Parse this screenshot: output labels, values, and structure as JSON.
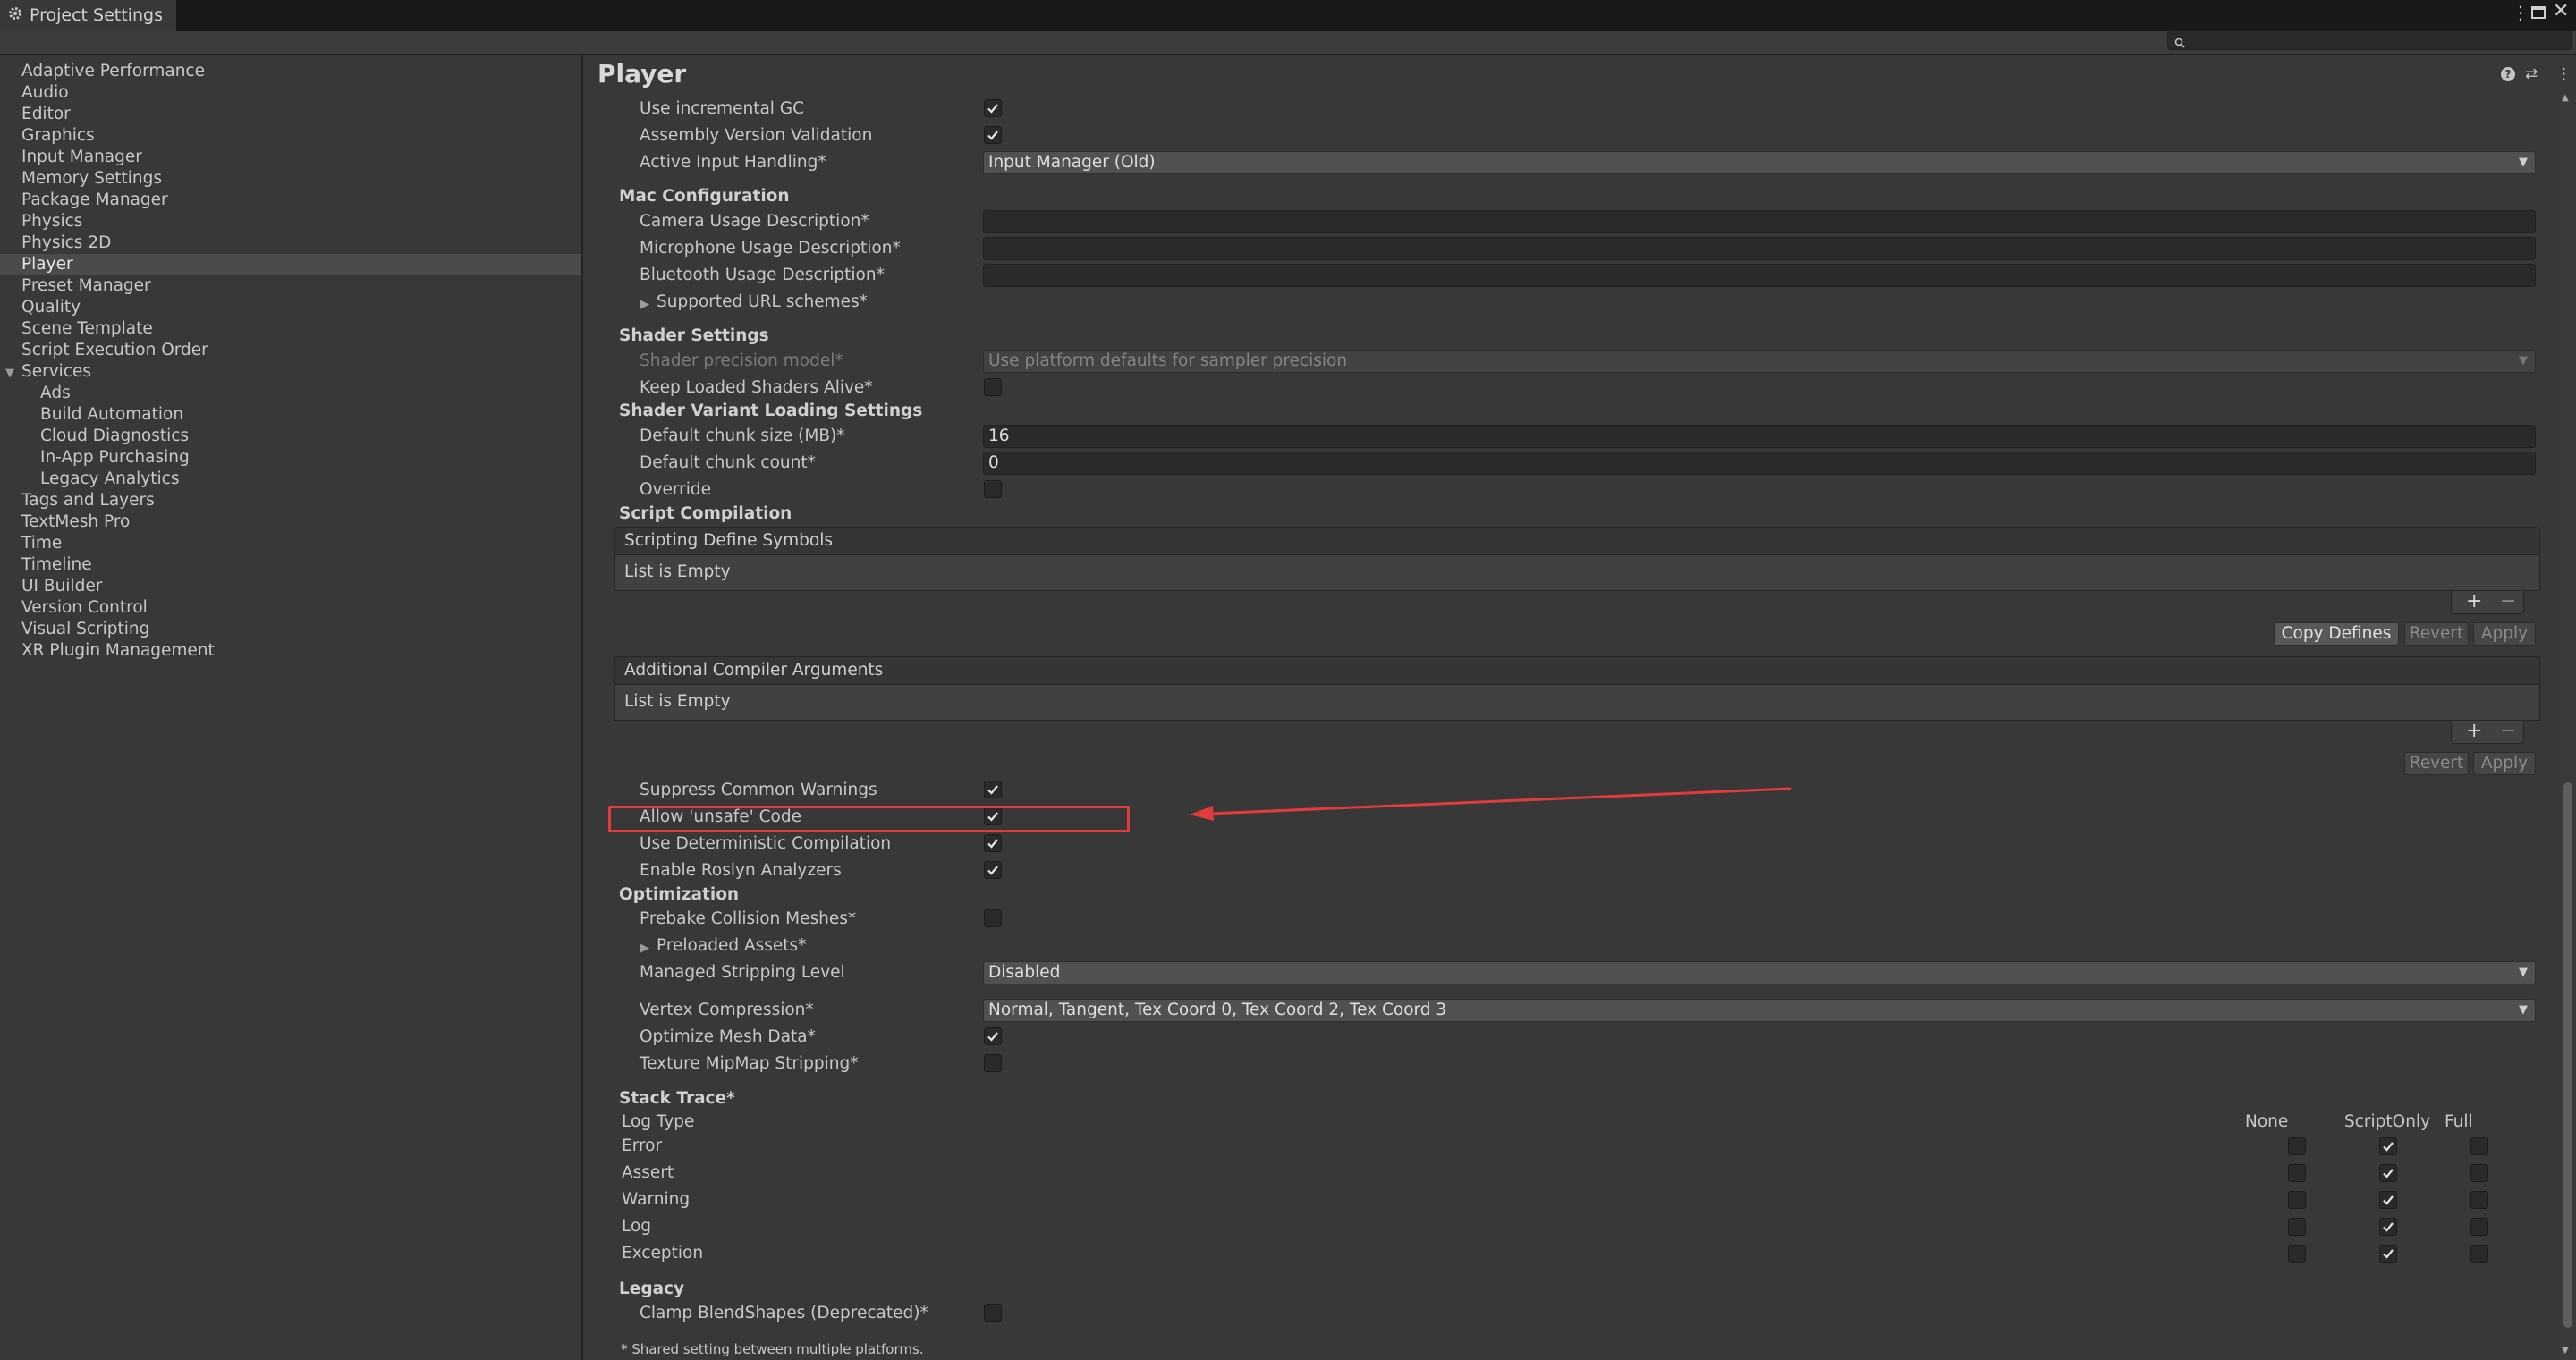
{
  "window": {
    "title": "Project Settings"
  },
  "sidebar": {
    "items": [
      {
        "label": "Adaptive Performance"
      },
      {
        "label": "Audio"
      },
      {
        "label": "Editor"
      },
      {
        "label": "Graphics"
      },
      {
        "label": "Input Manager"
      },
      {
        "label": "Memory Settings"
      },
      {
        "label": "Package Manager"
      },
      {
        "label": "Physics"
      },
      {
        "label": "Physics 2D"
      },
      {
        "label": "Player"
      },
      {
        "label": "Preset Manager"
      },
      {
        "label": "Quality"
      },
      {
        "label": "Scene Template"
      },
      {
        "label": "Script Execution Order"
      },
      {
        "label": "Services"
      },
      {
        "label": "Ads"
      },
      {
        "label": "Build Automation"
      },
      {
        "label": "Cloud Diagnostics"
      },
      {
        "label": "In-App Purchasing"
      },
      {
        "label": "Legacy Analytics"
      },
      {
        "label": "Tags and Layers"
      },
      {
        "label": "TextMesh Pro"
      },
      {
        "label": "Time"
      },
      {
        "label": "Timeline"
      },
      {
        "label": "UI Builder"
      },
      {
        "label": "Version Control"
      },
      {
        "label": "Visual Scripting"
      },
      {
        "label": "XR Plugin Management"
      }
    ],
    "selected": "Player"
  },
  "main": {
    "title": "Player",
    "rows": {
      "use_incremental_gc": {
        "label": "Use incremental GC",
        "checked": true
      },
      "assembly_version_validation": {
        "label": "Assembly Version Validation",
        "checked": true
      },
      "active_input_handling": {
        "label": "Active Input Handling*",
        "value": "Input Manager (Old)"
      },
      "mac_configuration": {
        "label": "Mac Configuration"
      },
      "camera_usage": {
        "label": "Camera Usage Description*",
        "value": ""
      },
      "microphone_usage": {
        "label": "Microphone Usage Description*",
        "value": ""
      },
      "bluetooth_usage": {
        "label": "Bluetooth Usage Description*",
        "value": ""
      },
      "supported_url_schemes": {
        "label": "Supported URL schemes*"
      },
      "shader_settings": {
        "label": "Shader Settings"
      },
      "shader_precision_model": {
        "label": "Shader precision model*",
        "value": "Use platform defaults for sampler precision"
      },
      "keep_loaded_shaders": {
        "label": "Keep Loaded Shaders Alive*",
        "checked": false
      },
      "shader_variant_loading": {
        "label": "Shader Variant Loading Settings"
      },
      "default_chunk_size": {
        "label": "Default chunk size (MB)*",
        "value": "16"
      },
      "default_chunk_count": {
        "label": "Default chunk count*",
        "value": "0"
      },
      "override": {
        "label": "Override",
        "checked": false
      },
      "script_compilation": {
        "label": "Script Compilation"
      },
      "scripting_define_symbols": {
        "label": "Scripting Define Symbols",
        "empty": "List is Empty"
      },
      "additional_compiler_args": {
        "label": "Additional Compiler Arguments",
        "empty": "List is Empty"
      },
      "suppress_common_warnings": {
        "label": "Suppress Common Warnings",
        "checked": true
      },
      "allow_unsafe_code": {
        "label": "Allow 'unsafe' Code",
        "checked": true
      },
      "use_deterministic_compilation": {
        "label": "Use Deterministic Compilation",
        "checked": true
      },
      "enable_roslyn_analyzers": {
        "label": "Enable Roslyn Analyzers",
        "checked": true
      },
      "optimization": {
        "label": "Optimization"
      },
      "prebake_collision_meshes": {
        "label": "Prebake Collision Meshes*",
        "checked": false
      },
      "preloaded_assets": {
        "label": "Preloaded Assets*"
      },
      "managed_stripping_level": {
        "label": "Managed Stripping Level",
        "value": "Disabled"
      },
      "vertex_compression": {
        "label": "Vertex Compression*",
        "value": "Normal, Tangent, Tex Coord 0, Tex Coord 2, Tex Coord 3"
      },
      "optimize_mesh_data": {
        "label": "Optimize Mesh Data*",
        "checked": true
      },
      "texture_mipmap_stripping": {
        "label": "Texture MipMap Stripping*",
        "checked": false
      },
      "stack_trace": {
        "label": "Stack Trace*"
      },
      "legacy": {
        "label": "Legacy"
      },
      "clamp_blendshapes": {
        "label": "Clamp BlendShapes (Deprecated)*",
        "checked": false
      },
      "footnote": {
        "label": "* Shared setting between multiple platforms."
      }
    },
    "buttons": {
      "copy_defines": "Copy Defines",
      "revert": "Revert",
      "apply": "Apply",
      "plus": "+",
      "minus": "−"
    },
    "stack_trace_table": {
      "header": "Log Type",
      "columns": [
        "None",
        "ScriptOnly",
        "Full"
      ],
      "rows": [
        {
          "type": "Error",
          "selected": "ScriptOnly"
        },
        {
          "type": "Assert",
          "selected": "ScriptOnly"
        },
        {
          "type": "Warning",
          "selected": "ScriptOnly"
        },
        {
          "type": "Log",
          "selected": "ScriptOnly"
        },
        {
          "type": "Exception",
          "selected": "ScriptOnly"
        }
      ]
    }
  },
  "annotation": {
    "color": "#e23b3b"
  }
}
